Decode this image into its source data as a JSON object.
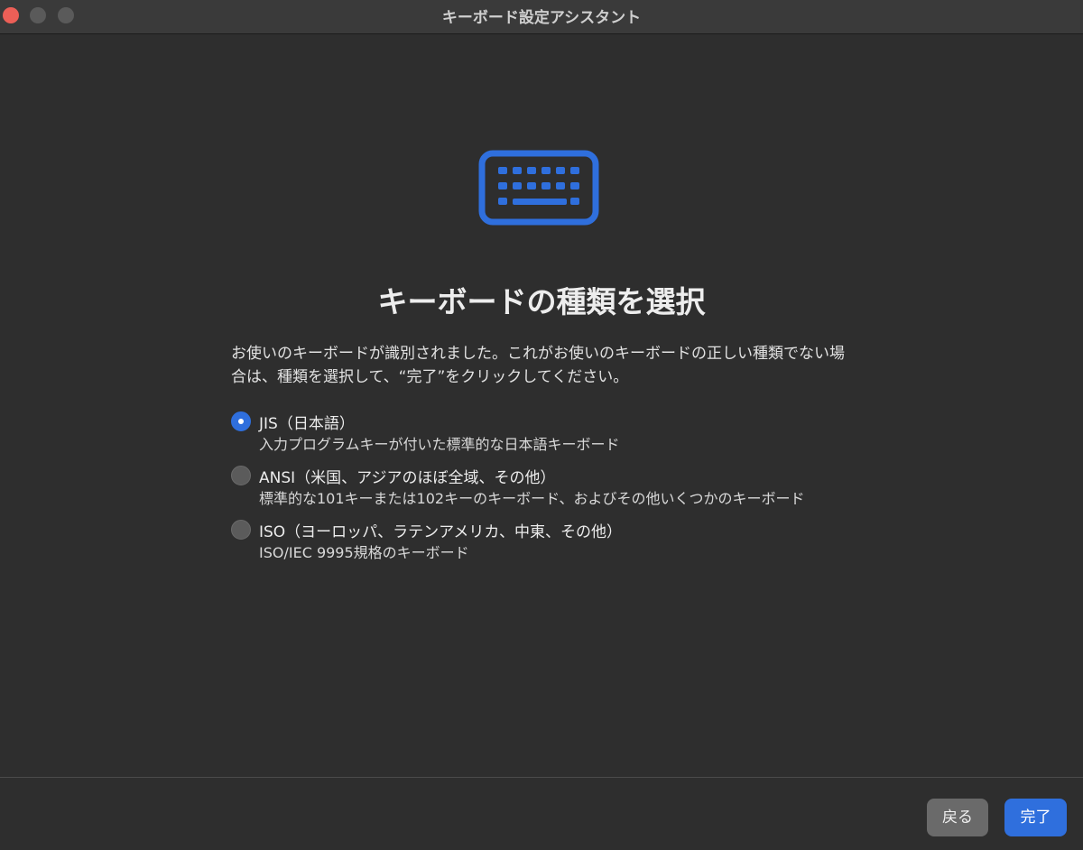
{
  "window": {
    "title": "キーボード設定アシスタント"
  },
  "hero": {
    "icon": "keyboard-icon",
    "accent_color": "#2f6fdd"
  },
  "heading": "キーボードの種類を選択",
  "description": "お使いのキーボードが識別されました。これがお使いのキーボードの正しい種類でない場合は、種類を選択して、“完了”をクリックしてください。",
  "options": [
    {
      "title": "JIS（日本語）",
      "subtitle": "入力プログラムキーが付いた標準的な日本語キーボード",
      "selected": true
    },
    {
      "title": "ANSI（米国、アジアのほぼ全域、その他）",
      "subtitle": "標準的な101キーまたは102キーのキーボード、およびその他いくつかのキーボード",
      "selected": false
    },
    {
      "title": "ISO（ヨーロッパ、ラテンアメリカ、中東、その他）",
      "subtitle": "ISO/IEC 9995規格のキーボード",
      "selected": false
    }
  ],
  "buttons": {
    "back_label": "戻る",
    "done_label": "完了"
  }
}
